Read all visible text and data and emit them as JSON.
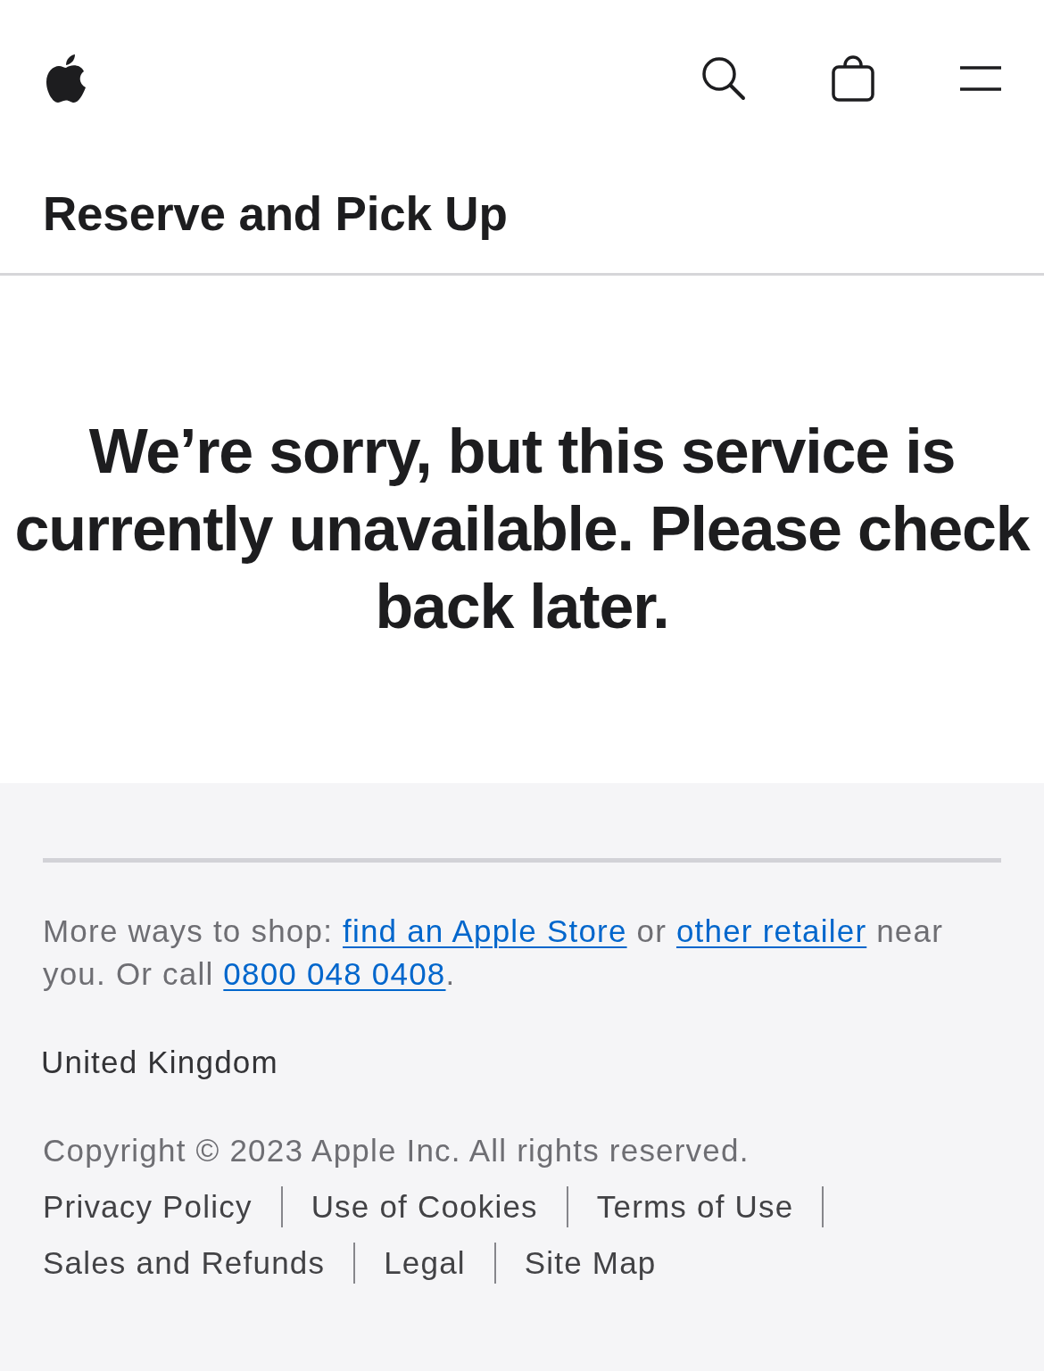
{
  "header": {
    "title": "Reserve and Pick Up"
  },
  "message": "We’re sorry, but this service is currently unavailable. Please check back later.",
  "footer": {
    "shop_info": [
      {
        "kind": "text",
        "text": "More ways to shop: "
      },
      {
        "kind": "link",
        "text": "find an Apple Store"
      },
      {
        "kind": "text",
        "text": " or "
      },
      {
        "kind": "link",
        "text": "other retailer"
      },
      {
        "kind": "text",
        "text": " near you. Or call "
      },
      {
        "kind": "link",
        "text": "0800 048 0408"
      },
      {
        "kind": "text",
        "text": "."
      }
    ],
    "country": "United Kingdom",
    "copyright": "Copyright © 2023 Apple Inc. All rights reserved.",
    "links": [
      "Privacy Policy",
      "Use of Cookies",
      "Terms of Use",
      "Sales and Refunds",
      "Legal",
      "Site Map"
    ]
  }
}
